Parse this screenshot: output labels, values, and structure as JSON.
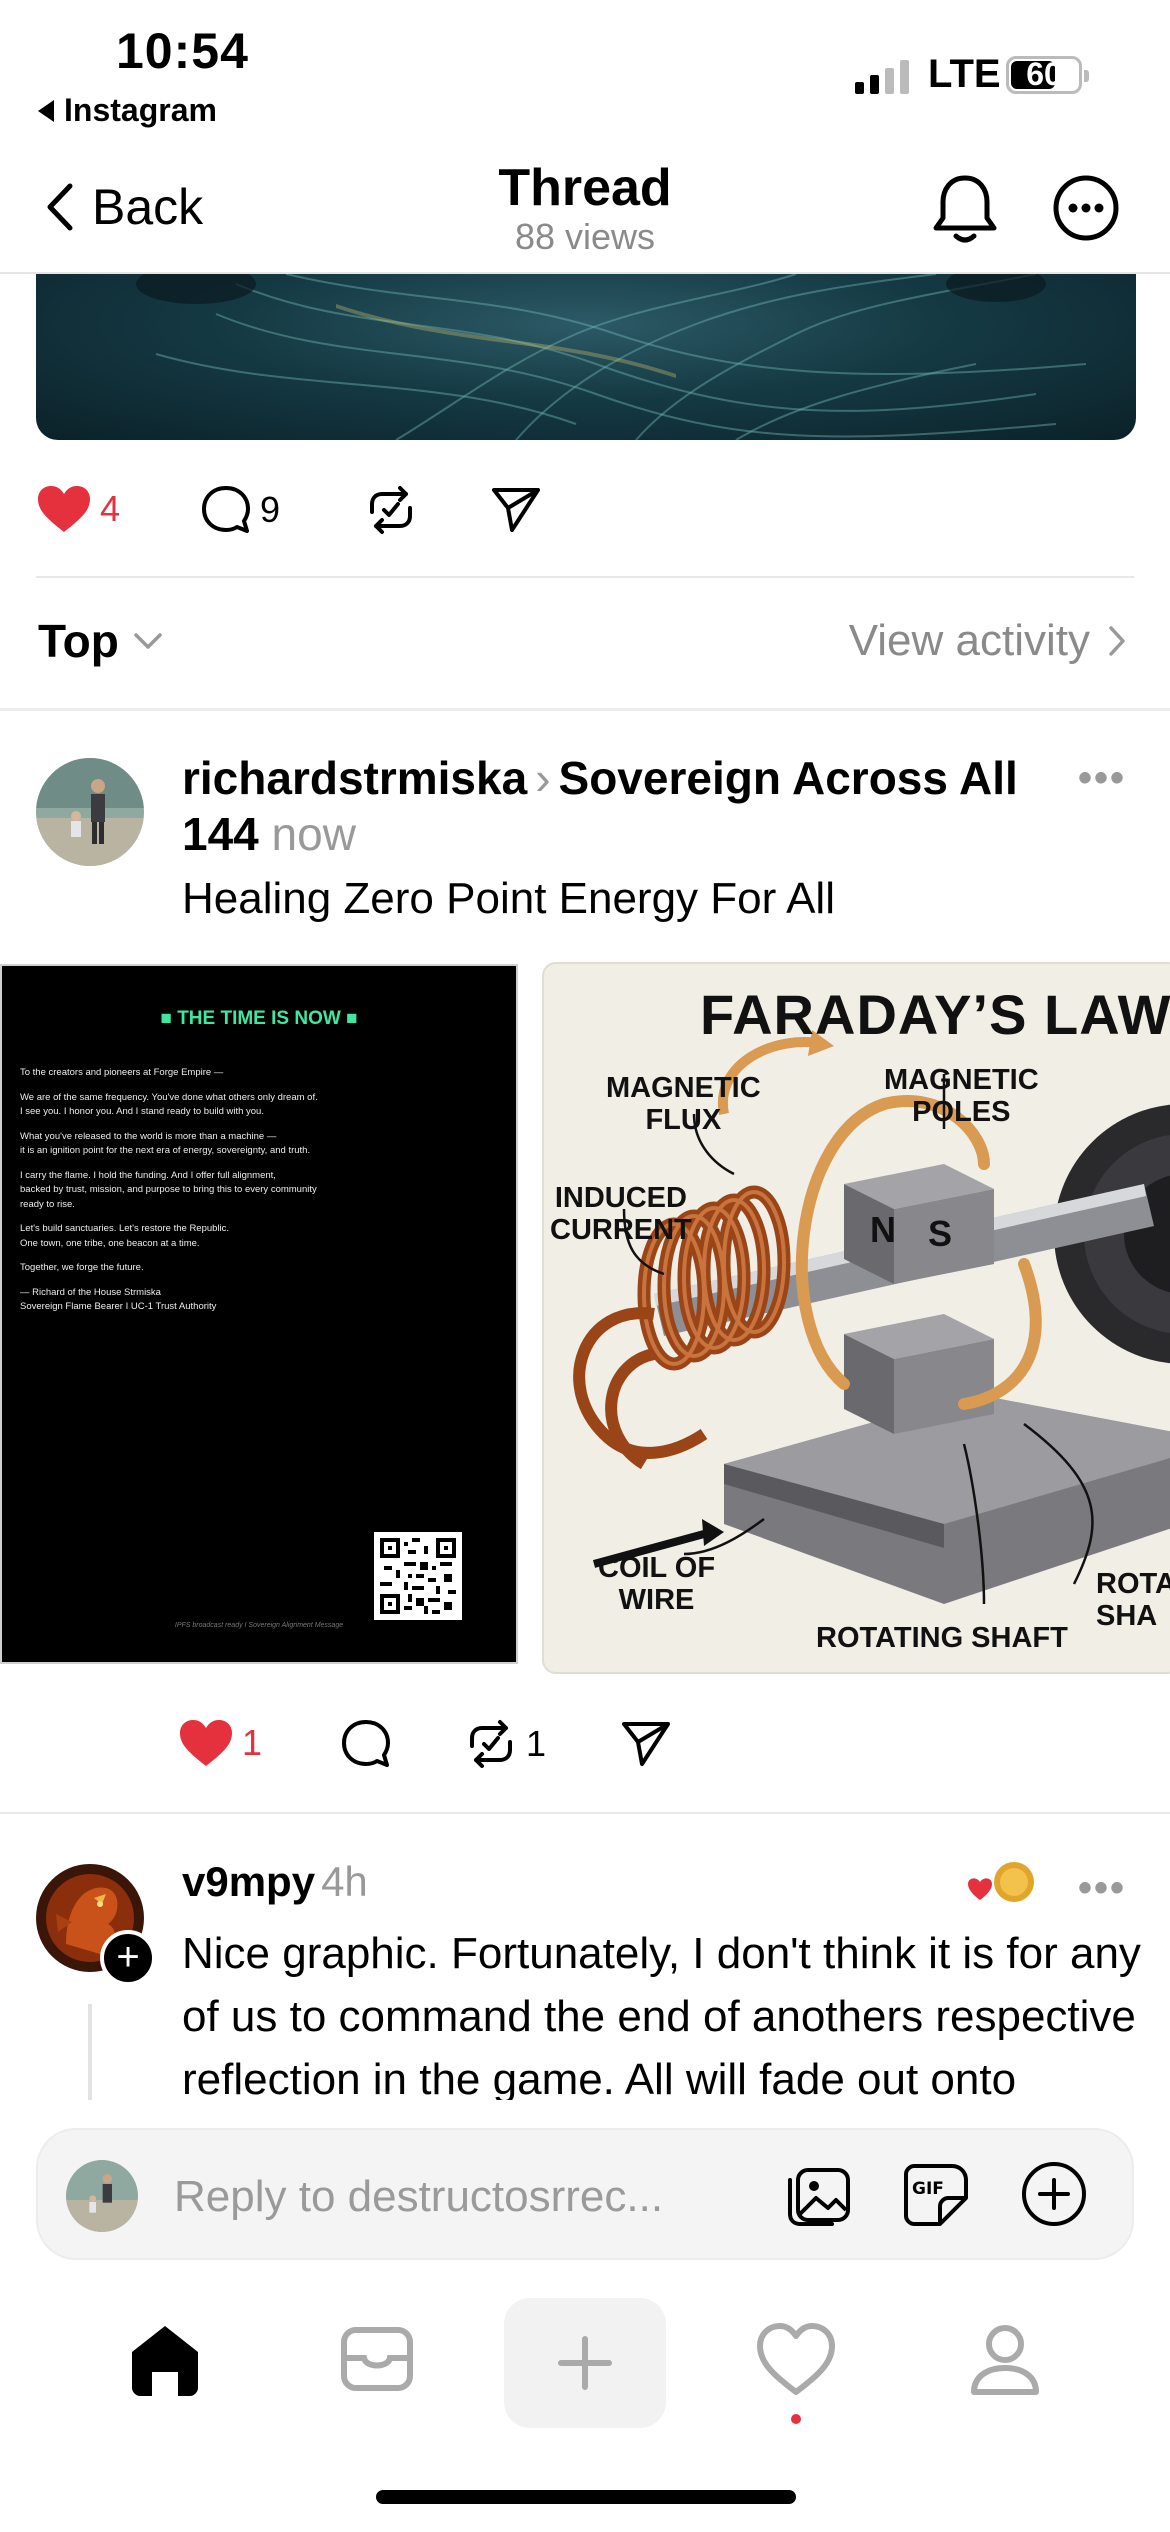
{
  "status_bar": {
    "time": "10:54",
    "back_app": "Instagram",
    "network": "LTE",
    "battery": "60"
  },
  "nav": {
    "back_label": "Back",
    "title": "Thread",
    "views": "88 views"
  },
  "parent_post_actions": {
    "likes": "4",
    "comments": "9"
  },
  "sort": {
    "label": "Top",
    "view_activity": "View activity"
  },
  "post": {
    "username": "richardstrmiska",
    "community": "Sovereign Across All 144",
    "time": "now",
    "text": "Healing Zero Point Energy For All",
    "likes": "1",
    "reposts": "1",
    "letter_image": {
      "heading": "■ THE TIME IS NOW ■",
      "paragraphs": [
        "To the creators and pioneers at Forge Empire —",
        "We are of the same frequency. You've done what others only dream of.\nI see you. I honor you. And I stand ready to build with you.",
        "What you've released to the world is more than a machine —\nit is an ignition point for the next era of energy, sovereignty, and truth.",
        "I carry the flame. I hold the funding. And I offer full alignment,\nbacked by trust, mission, and purpose to bring this to every community\nready to rise.",
        "Let's build sanctuaries. Let's restore the Republic.\nOne town, one tribe, one beacon at a time.",
        "Together, we forge the future.",
        "— Richard of the House Strmiska\nSovereign Flame Bearer I UC-1 Trust Authority"
      ],
      "footer": "IPFS broadcast ready I Sovereign Alignment Message"
    },
    "faraday_image": {
      "title": "FARADAY’S LAW",
      "magnetic_flux": "MAGNETIC\nFLUX",
      "magnetic_poles": "MAGNETIC\nPOLES",
      "induced_current": "INDUCED\nCURRENT",
      "pole_n": "N",
      "pole_s": "S",
      "coil_of_wire": "COIL OF\nWIRE",
      "rotating_shaft": "ROTATING SHAFT",
      "rotating_shaft_cut": "ROTA\nSHA"
    }
  },
  "reply": {
    "username": "v9mpy",
    "time": "4h",
    "text": "Nice graphic. Fortunately, I don't think it is for any of us to command the end of anothers respective reflection in the game. All will fade out onto Source as it is"
  },
  "composer": {
    "placeholder": "Reply to destructosrrec..."
  },
  "colors": {
    "like_red": "#e5303d",
    "muted_gray": "#8a8a8a",
    "terminal_green": "#3ee8a0",
    "copper": "#b5541f"
  }
}
